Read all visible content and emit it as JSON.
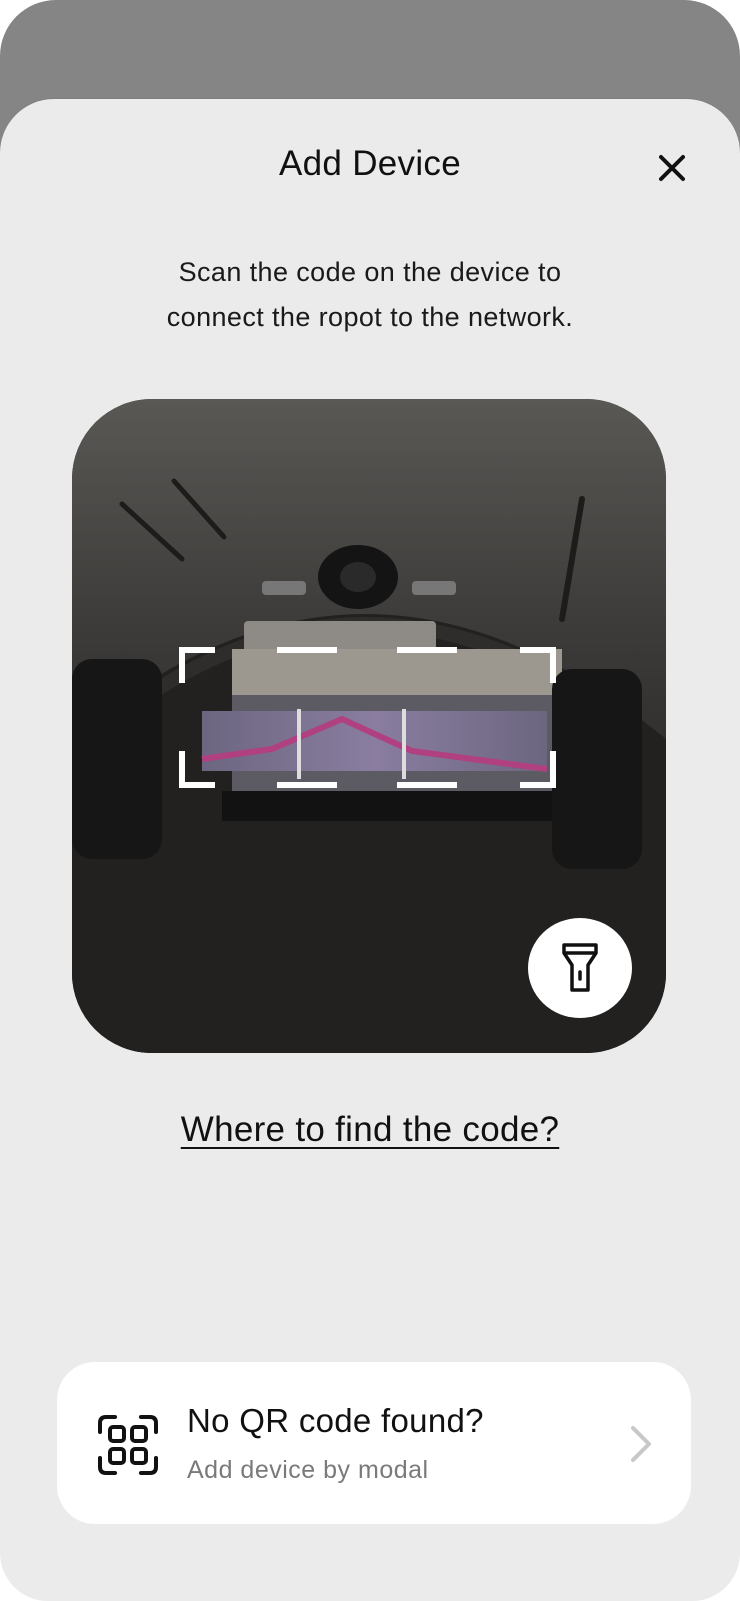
{
  "header": {
    "title": "Add Device",
    "close_icon": "close-icon"
  },
  "instruction": {
    "line1": "Scan the code on the device to",
    "line2": "connect the ropot to the network."
  },
  "scanner": {
    "flashlight_icon": "flashlight-icon",
    "frame_color": "#ffffff"
  },
  "help": {
    "link_text": "Where to find the code?"
  },
  "manual_add": {
    "title": "No QR code found?",
    "subtitle": "Add device by modal",
    "icon": "qr-scan-icon",
    "chevron_icon": "chevron-right-icon"
  },
  "colors": {
    "sheet_background": "#ebebeb",
    "backdrop": "#858585",
    "text_primary": "#111111",
    "text_secondary": "#7a7a7a"
  }
}
